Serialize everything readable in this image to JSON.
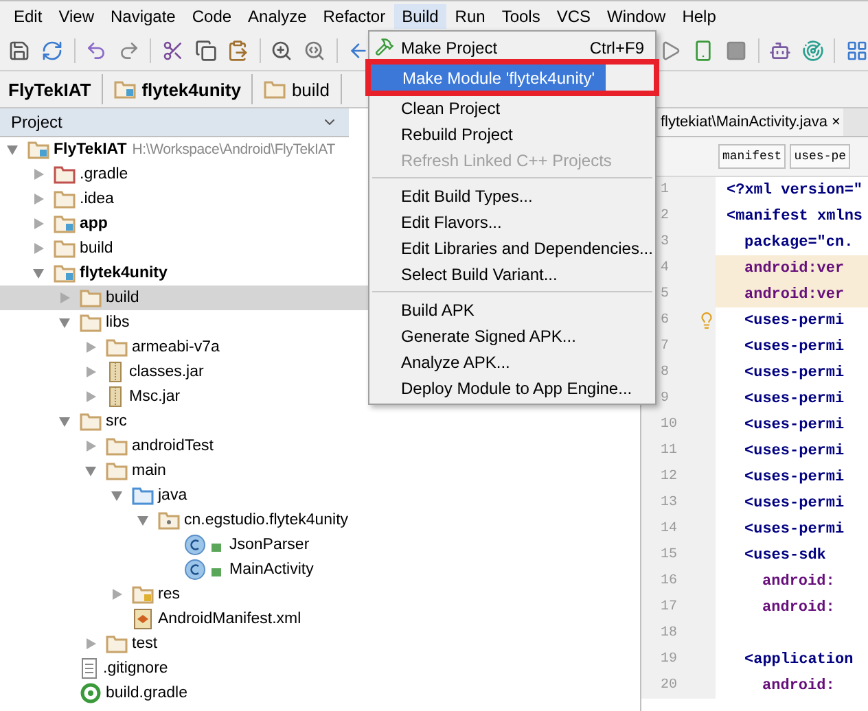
{
  "menu_bar": [
    {
      "label": "Edit",
      "open": false
    },
    {
      "label": "View",
      "open": false
    },
    {
      "label": "Navigate",
      "open": false
    },
    {
      "label": "Code",
      "open": false
    },
    {
      "label": "Analyze",
      "open": false
    },
    {
      "label": "Refactor",
      "open": false
    },
    {
      "label": "Build",
      "open": true
    },
    {
      "label": "Run",
      "open": false
    },
    {
      "label": "Tools",
      "open": false
    },
    {
      "label": "VCS",
      "open": false
    },
    {
      "label": "Window",
      "open": false
    },
    {
      "label": "Help",
      "open": false
    }
  ],
  "breadcrumb": [
    {
      "label": "FlyTekIAT",
      "kind": "project"
    },
    {
      "label": "flytek4unity",
      "kind": "module"
    },
    {
      "label": "build",
      "kind": "folder"
    }
  ],
  "project_panel": {
    "title": "Project"
  },
  "tree": [
    {
      "name": "FlyTekIAT",
      "path": "H:\\Workspace\\Android\\FlyTekIAT",
      "kind": "project",
      "bold": true,
      "expanded": true,
      "selected": false,
      "children": [
        {
          "name": ".gradle",
          "kind": "excluded",
          "bold": false,
          "expanded": false,
          "selected": false
        },
        {
          "name": ".idea",
          "kind": "folder",
          "bold": false,
          "expanded": false,
          "selected": false
        },
        {
          "name": "app",
          "kind": "module",
          "bold": true,
          "expanded": false,
          "selected": false
        },
        {
          "name": "build",
          "kind": "folder",
          "bold": false,
          "expanded": false,
          "selected": false
        },
        {
          "name": "flytek4unity",
          "kind": "module",
          "bold": true,
          "expanded": true,
          "selected": false,
          "children": [
            {
              "name": "build",
              "kind": "folder",
              "bold": false,
              "expanded": false,
              "selected": true
            },
            {
              "name": "libs",
              "kind": "folder",
              "bold": false,
              "expanded": true,
              "selected": false,
              "children": [
                {
                  "name": "armeabi-v7a",
                  "kind": "folder",
                  "bold": false,
                  "expanded": false,
                  "selected": false
                },
                {
                  "name": "classes.jar",
                  "kind": "jar",
                  "bold": false,
                  "expanded": false,
                  "selected": false
                },
                {
                  "name": "Msc.jar",
                  "kind": "jar",
                  "bold": false,
                  "expanded": false,
                  "selected": false
                }
              ]
            },
            {
              "name": "src",
              "kind": "folder",
              "bold": false,
              "expanded": true,
              "selected": false,
              "children": [
                {
                  "name": "androidTest",
                  "kind": "folder",
                  "bold": false,
                  "expanded": false,
                  "selected": false
                },
                {
                  "name": "main",
                  "kind": "folder",
                  "bold": false,
                  "expanded": true,
                  "selected": false,
                  "children": [
                    {
                      "name": "java",
                      "kind": "source",
                      "bold": false,
                      "expanded": true,
                      "selected": false,
                      "children": [
                        {
                          "name": "cn.egstudio.flytek4unity",
                          "kind": "package",
                          "bold": false,
                          "expanded": true,
                          "selected": false,
                          "children": [
                            {
                              "name": "JsonParser",
                              "kind": "class",
                              "bold": false,
                              "selected": false
                            },
                            {
                              "name": "MainActivity",
                              "kind": "class",
                              "bold": false,
                              "selected": false
                            }
                          ]
                        }
                      ]
                    },
                    {
                      "name": "res",
                      "kind": "resources",
                      "bold": false,
                      "expanded": false,
                      "selected": false
                    },
                    {
                      "name": "AndroidManifest.xml",
                      "kind": "manifest",
                      "bold": false,
                      "selected": false
                    }
                  ]
                },
                {
                  "name": "test",
                  "kind": "folder",
                  "bold": false,
                  "expanded": false,
                  "selected": false
                }
              ]
            },
            {
              "name": ".gitignore",
              "kind": "file",
              "bold": false,
              "selected": false
            },
            {
              "name": "build.gradle",
              "kind": "gradle",
              "bold": false,
              "selected": false
            }
          ]
        }
      ]
    }
  ],
  "build_menu": [
    {
      "kind": "tool",
      "label": "Make Project",
      "shortcut": "Ctrl+F9",
      "disabled": false,
      "selected": false,
      "annotated": false
    },
    {
      "kind": "item",
      "label": "Make Module 'flytek4unity'",
      "disabled": false,
      "selected": true,
      "annotated": true
    },
    {
      "kind": "item",
      "label": "Clean Project",
      "disabled": false,
      "selected": false,
      "annotated": false
    },
    {
      "kind": "item",
      "label": "Rebuild Project",
      "disabled": false,
      "selected": false,
      "annotated": false
    },
    {
      "kind": "item",
      "label": "Refresh Linked C++ Projects",
      "disabled": true,
      "selected": false,
      "annotated": false
    },
    {
      "kind": "separator"
    },
    {
      "kind": "item",
      "label": "Edit Build Types...",
      "disabled": false,
      "selected": false,
      "annotated": false
    },
    {
      "kind": "item",
      "label": "Edit Flavors...",
      "disabled": false,
      "selected": false,
      "annotated": false
    },
    {
      "kind": "item",
      "label": "Edit Libraries and Dependencies...",
      "disabled": false,
      "selected": false,
      "annotated": false
    },
    {
      "kind": "item",
      "label": "Select Build Variant...",
      "disabled": false,
      "selected": false,
      "annotated": false
    },
    {
      "kind": "separator"
    },
    {
      "kind": "item",
      "label": "Build APK",
      "disabled": false,
      "selected": false,
      "annotated": false
    },
    {
      "kind": "item",
      "label": "Generate Signed APK...",
      "disabled": false,
      "selected": false,
      "annotated": false
    },
    {
      "kind": "item",
      "label": "Analyze APK...",
      "disabled": false,
      "selected": false,
      "annotated": false
    },
    {
      "kind": "item",
      "label": "Deploy Module to App Engine...",
      "disabled": false,
      "selected": false,
      "annotated": false
    }
  ],
  "editor": {
    "tab": {
      "label": "flytekiat\\MainActivity.java",
      "close": "×",
      "selected": true
    },
    "tag_path": [
      "manifest",
      "uses-pe"
    ],
    "lines": [
      {
        "number": "1",
        "code": "<?xml version=\"",
        "kind": "tag",
        "highlighted": false
      },
      {
        "number": "2",
        "code": "<manifest xmlns",
        "kind": "tag",
        "highlighted": false,
        "children": [
          {
            "number": "3",
            "code": "package=\"cn.",
            "kind": "tag",
            "highlighted": false
          },
          {
            "number": "4",
            "code": "android:ver",
            "kind": "attr",
            "highlighted": true
          },
          {
            "number": "5",
            "code": "android:ver",
            "kind": "attr",
            "highlighted": true
          },
          {
            "number": "6",
            "code": "<uses-permi",
            "kind": "tag",
            "highlighted": false,
            "bulb": true
          },
          {
            "number": "7",
            "code": "<uses-permi",
            "kind": "tag",
            "highlighted": false
          },
          {
            "number": "8",
            "code": "<uses-permi",
            "kind": "tag",
            "highlighted": false
          },
          {
            "number": "9",
            "code": "<uses-permi",
            "kind": "tag",
            "highlighted": false
          },
          {
            "number": "10",
            "code": "<uses-permi",
            "kind": "tag",
            "highlighted": false
          },
          {
            "number": "11",
            "code": "<uses-permi",
            "kind": "tag",
            "highlighted": false
          },
          {
            "number": "12",
            "code": "<uses-permi",
            "kind": "tag",
            "highlighted": false
          },
          {
            "number": "13",
            "code": "<uses-permi",
            "kind": "tag",
            "highlighted": false
          },
          {
            "number": "14",
            "code": "<uses-permi",
            "kind": "tag",
            "highlighted": false
          },
          {
            "number": "15",
            "code": "<uses-sdk",
            "kind": "tag",
            "highlighted": false,
            "children": [
              {
                "number": "16",
                "code": "android:",
                "kind": "attr",
                "highlighted": false
              },
              {
                "number": "17",
                "code": "android:",
                "kind": "attr",
                "highlighted": false
              }
            ]
          },
          {
            "number": "18",
            "kind": "blank",
            "highlighted": false
          },
          {
            "number": "19",
            "code": "<application",
            "kind": "tag",
            "highlighted": false,
            "children": [
              {
                "number": "20",
                "code": "android:",
                "kind": "attr",
                "highlighted": false
              }
            ]
          }
        ]
      }
    ]
  }
}
